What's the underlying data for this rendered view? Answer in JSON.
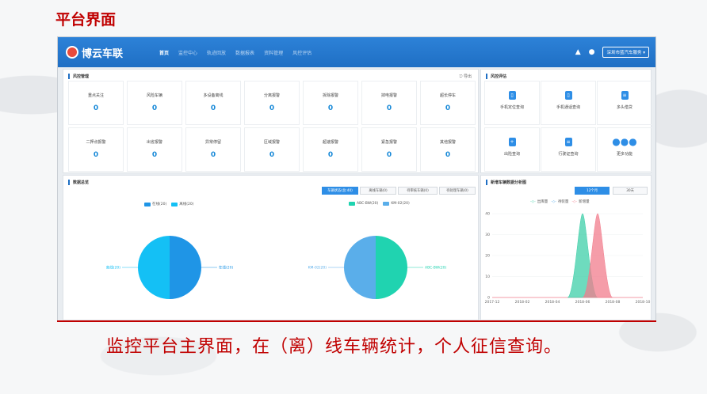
{
  "slide_title": "平台界面",
  "app": {
    "name": "博云车联"
  },
  "nav": [
    "首页",
    "监控中心",
    "轨迹回放",
    "数据报表",
    "资料管理",
    "风控评估"
  ],
  "header": {
    "user_label": "深圳市蓝汽车服务"
  },
  "risk_manage": {
    "title": "风控管理",
    "export_label": "导出",
    "cards": [
      {
        "label": "重点关注",
        "value": "0"
      },
      {
        "label": "风险车辆",
        "value": "0"
      },
      {
        "label": "多设备离线",
        "value": "0"
      },
      {
        "label": "分离报警",
        "value": "0"
      },
      {
        "label": "拆除报警",
        "value": "0"
      },
      {
        "label": "掉电报警",
        "value": "0"
      },
      {
        "label": "超长停车",
        "value": "0"
      },
      {
        "label": "二押点报警",
        "value": "0"
      },
      {
        "label": "出省报警",
        "value": "0"
      },
      {
        "label": "异常停留",
        "value": "0"
      },
      {
        "label": "区域报警",
        "value": "0"
      },
      {
        "label": "超速报警",
        "value": "0"
      },
      {
        "label": "紧急报警",
        "value": "0"
      },
      {
        "label": "其他报警",
        "value": "0"
      }
    ]
  },
  "risk_eval": {
    "title": "风控评估",
    "items": [
      {
        "label": "手机定位查询",
        "icon": "phone-locate-icon"
      },
      {
        "label": "手机通话查询",
        "icon": "phone-call-icon"
      },
      {
        "label": "多头借贷",
        "icon": "document-icon"
      },
      {
        "label": "出险查询",
        "icon": "shield-icon"
      },
      {
        "label": "行驶证查询",
        "icon": "license-icon"
      },
      {
        "label": "更多功能",
        "icon": "more-icon"
      }
    ]
  },
  "overview": {
    "title": "数据总览",
    "tabs": [
      "车辆状态(总:40)",
      "离线车辆(0)",
      "待审核车辆(0)",
      "待处理车辆(0)"
    ]
  },
  "trend": {
    "title": "新增车辆数据分析图",
    "tabs": [
      "12个月",
      "30天"
    ],
    "legend": [
      "出库量",
      "待装量",
      "新增量"
    ]
  },
  "caption": "监控平台主界面，在（离）线车辆统计，个人征信查询。",
  "colors": {
    "accent": "#1f6fc4",
    "online": "#1f95e6",
    "offline": "#14c0f5",
    "model_a": "#20d3b0",
    "model_b": "#5aaeea",
    "series_green": "#3dcfa8",
    "series_pink": "#f27c8c",
    "caption_red": "#c00000"
  },
  "chart_data": [
    {
      "type": "pie",
      "title": "",
      "labels": [
        "在线(20)",
        "离线(20)"
      ],
      "values": [
        20,
        20
      ],
      "legend": [
        "在线(20)",
        "离线(20)"
      ],
      "legend_position": "top"
    },
    {
      "type": "pie",
      "title": "",
      "labels": [
        "ABC-BW(20)",
        "KM-02(20)"
      ],
      "values": [
        20,
        20
      ],
      "legend": [
        "ABC-BW(20)",
        "KM-02(20)"
      ],
      "legend_position": "top"
    },
    {
      "type": "area",
      "title": "",
      "x": [
        "2017-12",
        "2018-02",
        "2018-04",
        "2018-06",
        "2018-08",
        "2018-10"
      ],
      "ylim": [
        0,
        40
      ],
      "yticks": [
        0,
        10,
        20,
        30,
        40
      ],
      "series": [
        {
          "name": "出库量",
          "x": [
            "2018-05",
            "2018-06",
            "2018-07"
          ],
          "values": [
            0,
            40,
            0
          ]
        },
        {
          "name": "新增量",
          "x": [
            "2018-06",
            "2018-07",
            "2018-08"
          ],
          "values": [
            0,
            40,
            0
          ]
        }
      ],
      "legend_position": "top"
    }
  ]
}
